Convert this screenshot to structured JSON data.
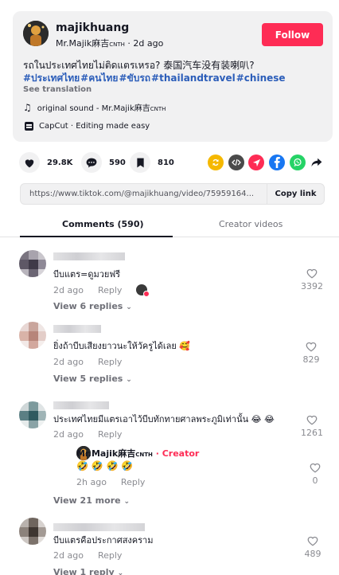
{
  "author": {
    "name": "majikhuang",
    "handle": "Mr.Majik麻吉",
    "handle_suffix": "CNTH",
    "posted": "2d ago",
    "follow_label": "Follow",
    "caption": "รถในประเทศไทยไม่ติดแตรเหรอ?  泰国汽车没有装喇叭?",
    "hashtags": [
      "#ประเทศไทย",
      "#คนไทย",
      "#ขับรถ",
      "#thailandtravel",
      "#chinese"
    ],
    "see_translation": "See translation",
    "sound": "original sound - Mr.Majik麻吉",
    "sound_suffix": "CNTH",
    "capcut": "CapCut · Editing made easy"
  },
  "actions": {
    "likes": "29.8K",
    "comments": "590",
    "saves": "810",
    "share_icons": [
      "repost-icon",
      "embed-icon",
      "send-icon",
      "facebook-icon",
      "whatsapp-icon",
      "share-arrow-icon"
    ],
    "colors": {
      "repost": "#f5b800",
      "embed": "#4a4a4a",
      "send": "#fe2c55",
      "facebook": "#1877f2",
      "whatsapp": "#25d366"
    }
  },
  "url_bar": {
    "url": "https://www.tiktok.com/@majikhuang/video/75959164...",
    "copy_label": "Copy link"
  },
  "tabs": {
    "comments_label": "Comments (590)",
    "creator_label": "Creator videos"
  },
  "comments": [
    {
      "text": "บีบแตร=ดูมวยฟรี",
      "time": "2d ago",
      "reply_label": "Reply",
      "likes": "3392",
      "view_replies": "View 6 replies"
    },
    {
      "text": "ยิ่งถ้าบีบเสียงยาวนะให้วัครูได้เลย 🥰",
      "time": "2d ago",
      "reply_label": "Reply",
      "likes": "829",
      "view_replies": "View 5 replies"
    },
    {
      "text": "ประเทศไทยมีแตรเอาไว้บีบทักทายศาลพระภูมิเท่านั้น 😂 😂",
      "time": "2d ago",
      "reply_label": "Reply",
      "likes": "1261",
      "reply": {
        "name": "Mr.Majik麻吉",
        "suffix": "CNTH",
        "creator": " · Creator",
        "text": "🤣 🤣 🤣 🤣",
        "time": "2h ago",
        "reply_label": "Reply",
        "likes": "0"
      },
      "view_replies": "View 21 more"
    },
    {
      "text": "บีบแตรคือประกาศสงคราม",
      "time": "2d ago",
      "reply_label": "Reply",
      "likes": "489",
      "view_replies": "View 1 reply"
    }
  ]
}
